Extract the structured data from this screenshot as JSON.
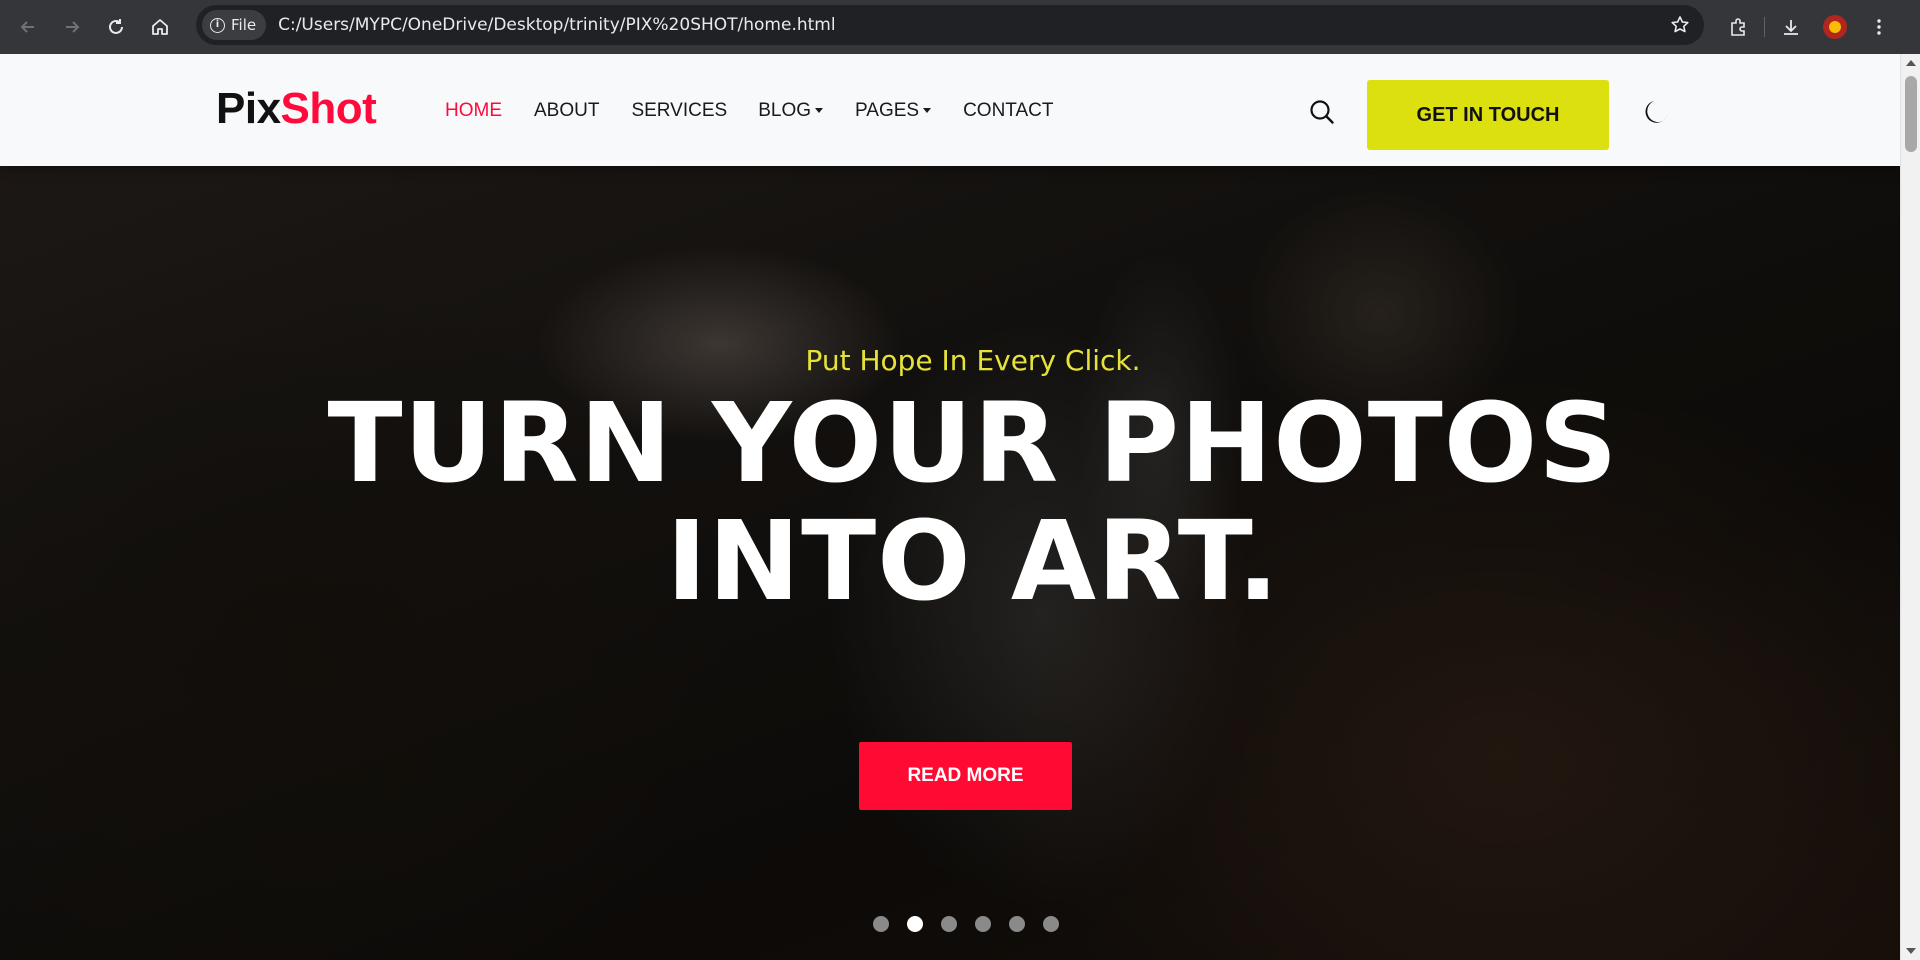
{
  "browser": {
    "file_label": "File",
    "url": "C:/Users/MYPC/OneDrive/Desktop/trinity/PIX%20SHOT/home.html"
  },
  "site": {
    "logo_part1": "Pix",
    "logo_part2": "Shot",
    "nav": [
      {
        "label": "HOME",
        "active": true
      },
      {
        "label": "ABOUT"
      },
      {
        "label": "SERVICES"
      },
      {
        "label": "BLOG",
        "dropdown": true
      },
      {
        "label": "PAGES",
        "dropdown": true
      },
      {
        "label": "CONTACT"
      }
    ],
    "cta_label": "GET IN TOUCH"
  },
  "hero": {
    "tagline": "Put Hope In Every Click.",
    "headline_line1": "TURN YOUR PHOTOS",
    "headline_line2": "INTO ART.",
    "button_label": "READ MORE",
    "slide_count": 6,
    "active_slide": 2
  },
  "colors": {
    "brand_red": "#ff0a3c",
    "cta_yellow": "#dce00e",
    "tagline_yellow": "#e6e23a"
  }
}
